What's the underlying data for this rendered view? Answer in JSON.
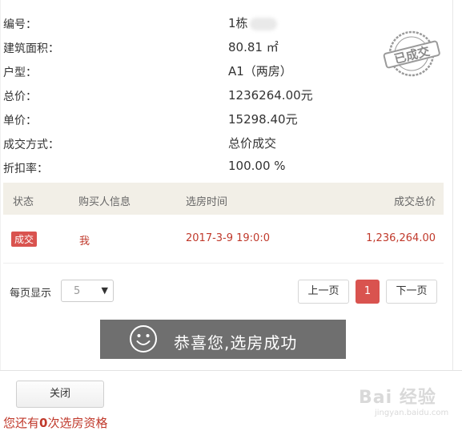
{
  "info": {
    "rows": [
      {
        "label": "编号：",
        "value": "1栋"
      },
      {
        "label": "建筑面积：",
        "value": "80.81 ㎡"
      },
      {
        "label": "户型：",
        "value": "A1（两房）"
      },
      {
        "label": "总价：",
        "value": "1236264.00元"
      },
      {
        "label": "单价：",
        "value": "15298.40元"
      },
      {
        "label": "成交方式：",
        "value": "总价成交"
      },
      {
        "label": "折扣率：",
        "value": "100.00 %"
      }
    ]
  },
  "stamp": {
    "text": "已成交",
    "color": "#9a9a9a"
  },
  "table": {
    "headers": {
      "status": "状态",
      "buyer": "购买人信息",
      "time": "选房时间",
      "total": "成交总价"
    },
    "rows": [
      {
        "status": "成交",
        "buyer": "我",
        "time": "2017-3-9 19:0:0",
        "total": "1,236,264.00"
      }
    ]
  },
  "pager": {
    "per_page_label": "每页显示",
    "per_page_value": "5",
    "prev_label": "上一页",
    "current_page": "1",
    "next_label": "下一页"
  },
  "toast": {
    "icon": "smiley-icon",
    "text": "恭喜您,选房成功"
  },
  "footer": {
    "close_label": "关闭",
    "quota_prefix": "您还有",
    "quota_count": "0",
    "quota_suffix": "次选房资格"
  },
  "watermark": {
    "logo": "Bai 经验",
    "url": "jingyan.baidu.com"
  },
  "colors": {
    "accent_red": "#d9534f",
    "text_red": "#c0392b",
    "header_bg": "#f2efe7",
    "toast_bg": "#6f6f6f"
  }
}
